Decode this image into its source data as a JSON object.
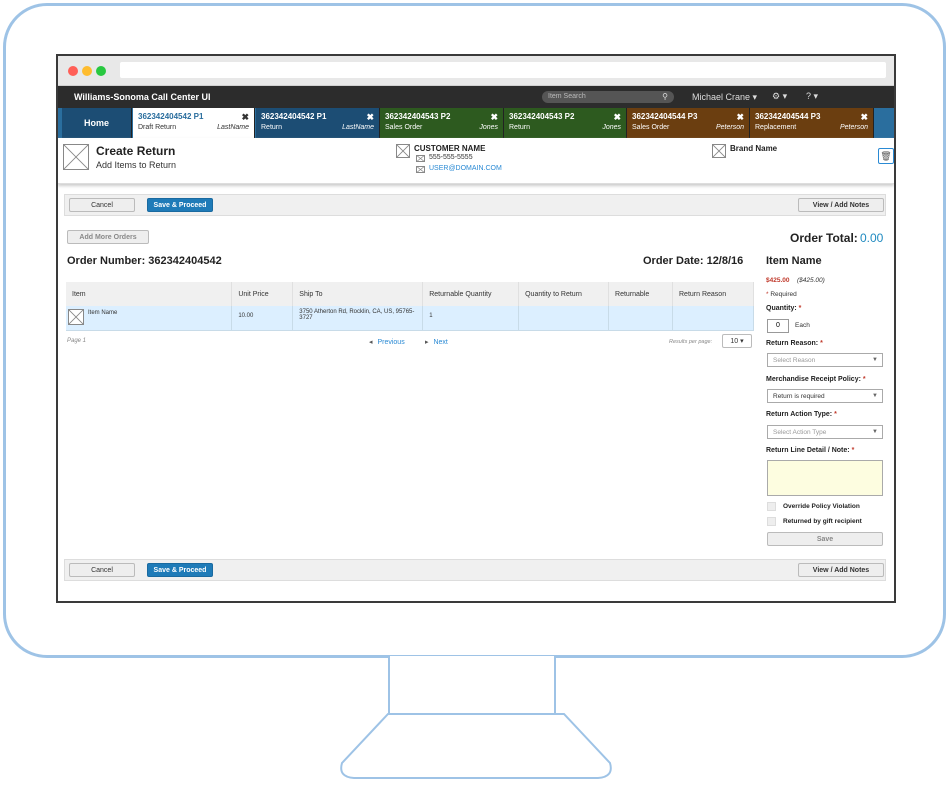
{
  "app": {
    "title": "Williams-Sonoma Call Center UI"
  },
  "search": {
    "placeholder": "Item Search"
  },
  "user": {
    "name": "Michael Crane ▾"
  },
  "tabs": [
    {
      "label": "Home"
    },
    {
      "order": "362342404542 P1",
      "type": "Draft Return",
      "name": "LastName"
    },
    {
      "order": "362342404542 P1",
      "type": "Return",
      "name": "LastName"
    },
    {
      "order": "362342404543 P2",
      "type": "Sales Order",
      "name": "Jones"
    },
    {
      "order": "362342404543 P2",
      "type": "Return",
      "name": "Jones"
    },
    {
      "order": "362342404544 P3",
      "type": "Sales Order",
      "name": "Peterson"
    },
    {
      "order": "362342404544 P3",
      "type": "Replacement",
      "name": "Peterson"
    }
  ],
  "colors": {
    "tab_blue": "#2a6e9e",
    "tab_green": "#2d5a1f",
    "tab_brown": "#6b3e10",
    "accent": "#1f7bb8"
  },
  "header": {
    "title": "Create Return",
    "subtitle": "Add Items to Return",
    "customer_name": "CUSTOMER NAME",
    "phone": "555-555-5555",
    "email": "USER@DOMAIN.COM",
    "brand": "Brand Name"
  },
  "toolbar": {
    "cancel": "Cancel",
    "save": "Save & Proceed",
    "notes": "View / Add Notes"
  },
  "add_more": "Add More Orders",
  "order_total_label": "Order Total:",
  "order_total_value": "0.00",
  "order_number": "Order Number: 362342404542",
  "order_date": "Order Date: 12/8/16",
  "table": {
    "headers": [
      "Item",
      "Unit Price",
      "Ship To",
      "Returnable Quantity",
      "Quantity to Return",
      "Returnable",
      "Return Reason"
    ],
    "row": {
      "item": "Item Name",
      "price": "10.00",
      "ship_to": "3750 Atherton Rd, Rocklin, CA, US, 95765-3727",
      "returnable_qty": "1"
    }
  },
  "pager": {
    "page": "Page 1",
    "prev": "Previous",
    "next": "Next",
    "per_page_label": "Results per page:",
    "per_page": "10"
  },
  "panel": {
    "item_name": "Item Name",
    "price": "$425.00",
    "price_orig": "($425.00)",
    "required": "Required",
    "quantity_label": "Quantity:",
    "quantity": "0",
    "each": "Each",
    "reason_label": "Return Reason:",
    "reason_placeholder": "Select Reason",
    "policy_label": "Merchandise Receipt Policy:",
    "policy_value": "Return is required",
    "action_label": "Return Action Type:",
    "action_placeholder": "Select Action Type",
    "note_label": "Return Line Detail / Note:",
    "override": "Override Policy Violation",
    "gift": "Returned by gift recipient",
    "save": "Save"
  }
}
